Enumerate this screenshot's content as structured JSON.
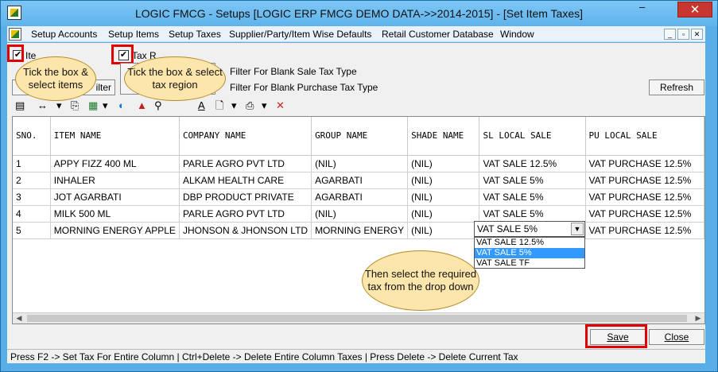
{
  "window": {
    "title": "LOGIC FMCG - Setups  [LOGIC ERP FMCG DEMO DATA->>2014-2015] - [Set Item Taxes]",
    "close_glyph": "✕",
    "min_glyph": "–"
  },
  "menu": [
    "Setup Accounts",
    "Setup Items",
    "Setup Taxes",
    "Supplier/Party/Item Wise Defaults",
    "Retail Customer Database",
    "Window"
  ],
  "mdi_controls": [
    "_",
    "▫",
    "✕"
  ],
  "filters": {
    "item_label_fragment": "Ite",
    "tax_label_fragment": "Tax R",
    "filter_button_fragment": "ilter",
    "blank_sale": "Filter For Blank Sale Tax Type",
    "blank_purchase": "Filter For Blank Purchase Tax Type",
    "refresh": "Refresh",
    "check_glyph": "✔"
  },
  "callouts": {
    "items": "Tick the box & select items",
    "tax_region": "Tick the box & select tax region",
    "dropdown": "Then select the required tax from the drop down"
  },
  "toolbar_icons": [
    "open-icon",
    "column-width-icon",
    "dropdown-arrow-icon",
    "copy-icon",
    "excel-icon",
    "dropdown-arrow-icon",
    "browser-icon",
    "up-arrow-icon",
    "binoculars-icon",
    "font-icon",
    "print-preview-icon",
    "dropdown-arrow-icon",
    "print-icon",
    "dropdown-arrow-icon",
    "delete-icon"
  ],
  "toolbar_glyphs": [
    "▤",
    "↔",
    "▾",
    "⎘",
    "▦",
    "▾",
    "◐",
    "▲",
    "⚲",
    "A",
    "🗋",
    "▾",
    "⎙",
    "▾",
    "✕"
  ],
  "table": {
    "columns": [
      "SNO.",
      "ITEM NAME",
      "COMPANY NAME",
      "GROUP NAME",
      "SHADE NAME",
      "SL LOCAL SALE",
      "PU LOCAL SALE"
    ],
    "rows": [
      [
        "1",
        "APPY FIZZ 400 ML",
        "PARLE AGRO PVT LTD",
        "(NIL)",
        "(NIL)",
        "VAT SALE 12.5%",
        "VAT PURCHASE 12.5%"
      ],
      [
        "2",
        "INHALER",
        "ALKAM HEALTH CARE",
        "AGARBATI",
        "(NIL)",
        "VAT SALE 5%",
        "VAT PURCHASE 12.5%"
      ],
      [
        "3",
        "JOT AGARBATI",
        "DBP PRODUCT PRIVATE",
        "AGARBATI",
        "(NIL)",
        "VAT SALE 5%",
        "VAT PURCHASE 12.5%"
      ],
      [
        "4",
        "MILK 500 ML",
        "PARLE AGRO PVT LTD",
        "(NIL)",
        "(NIL)",
        "VAT SALE 5%",
        "VAT PURCHASE 12.5%"
      ],
      [
        "5",
        "MORNING ENERGY APPLE",
        "JHONSON & JHONSON LTD",
        "MORNING ENERGY",
        "(NIL)",
        "",
        "VAT PURCHASE 12.5%"
      ]
    ]
  },
  "combo": {
    "value": "VAT SALE 5%",
    "arrow": "▼",
    "options": [
      "VAT SALE 12.5%",
      "VAT SALE 5%",
      "VAT SALE TF"
    ],
    "selected_index": 1
  },
  "buttons": {
    "save": "Save",
    "close": "Close"
  },
  "status": "Press F2 -> Set Tax For Entire Column  |  Ctrl+Delete -> Delete Entire Column Taxes  |  Press Delete -> Delete Current Tax",
  "colors": {
    "highlight": "#e00000",
    "selection": "#3399ff",
    "callout": "#fde6ac"
  }
}
